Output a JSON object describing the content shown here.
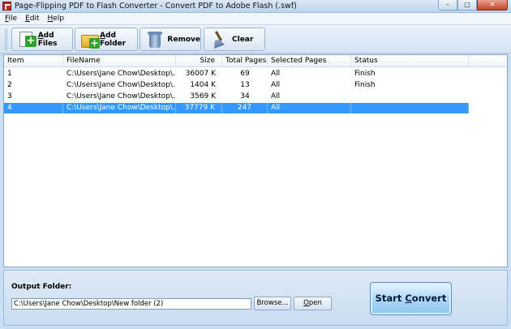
{
  "window": {
    "title": "Page-Flipping PDF to Flash Converter - Convert PDF to Adobe Flash (.swf)",
    "minimize_glyph": "–",
    "maximize_glyph": "□",
    "close_glyph": "✕"
  },
  "menu": {
    "items": [
      {
        "key": "F",
        "rest": "ile"
      },
      {
        "key": "E",
        "rest": "dit"
      },
      {
        "key": "H",
        "rest": "elp"
      }
    ]
  },
  "toolbar": {
    "add_files": {
      "key": "A",
      "rest": "dd Files",
      "icon": "add-files-icon"
    },
    "add_folder": {
      "key": "A",
      "rest": "dd Folder",
      "icon": "add-folder-icon"
    },
    "remove": {
      "label": "Remove",
      "icon": "trash-can-icon"
    },
    "clear": {
      "label": "Clear",
      "icon": "broom-icon"
    }
  },
  "file_list": {
    "columns": [
      "Item",
      "FileName",
      "Size",
      "Total Pages",
      "Selected Pages",
      "Status"
    ],
    "rows": [
      {
        "item": "1",
        "filename": "C:\\Users\\Jane Chow\\Desktop\\...",
        "size": "36007 K",
        "pages": "69",
        "selected": "All",
        "status": "Finish"
      },
      {
        "item": "2",
        "filename": "C:\\Users\\Jane Chow\\Desktop\\...",
        "size": "1404 K",
        "pages": "13",
        "selected": "All",
        "status": "Finish"
      },
      {
        "item": "3",
        "filename": "C:\\Users\\Jane Chow\\Desktop\\...",
        "size": "3569 K",
        "pages": "34",
        "selected": "All",
        "status": ""
      },
      {
        "item": "4",
        "filename": "C:\\Users\\Jane Chow\\Desktop\\...",
        "size": "37779 K",
        "pages": "247",
        "selected": "All",
        "status": ""
      }
    ],
    "selected_index": 3,
    "selection_color": "#3399ff"
  },
  "output": {
    "label": "Output Folder:",
    "path": "C:\\Users\\Jane Chow\\Desktop\\New folder (2)",
    "browse_label": "Browse...",
    "open_key": "O",
    "open_rest": "pen"
  },
  "start": {
    "key": "C",
    "prefix": "Start ",
    "rest": "onvert"
  }
}
